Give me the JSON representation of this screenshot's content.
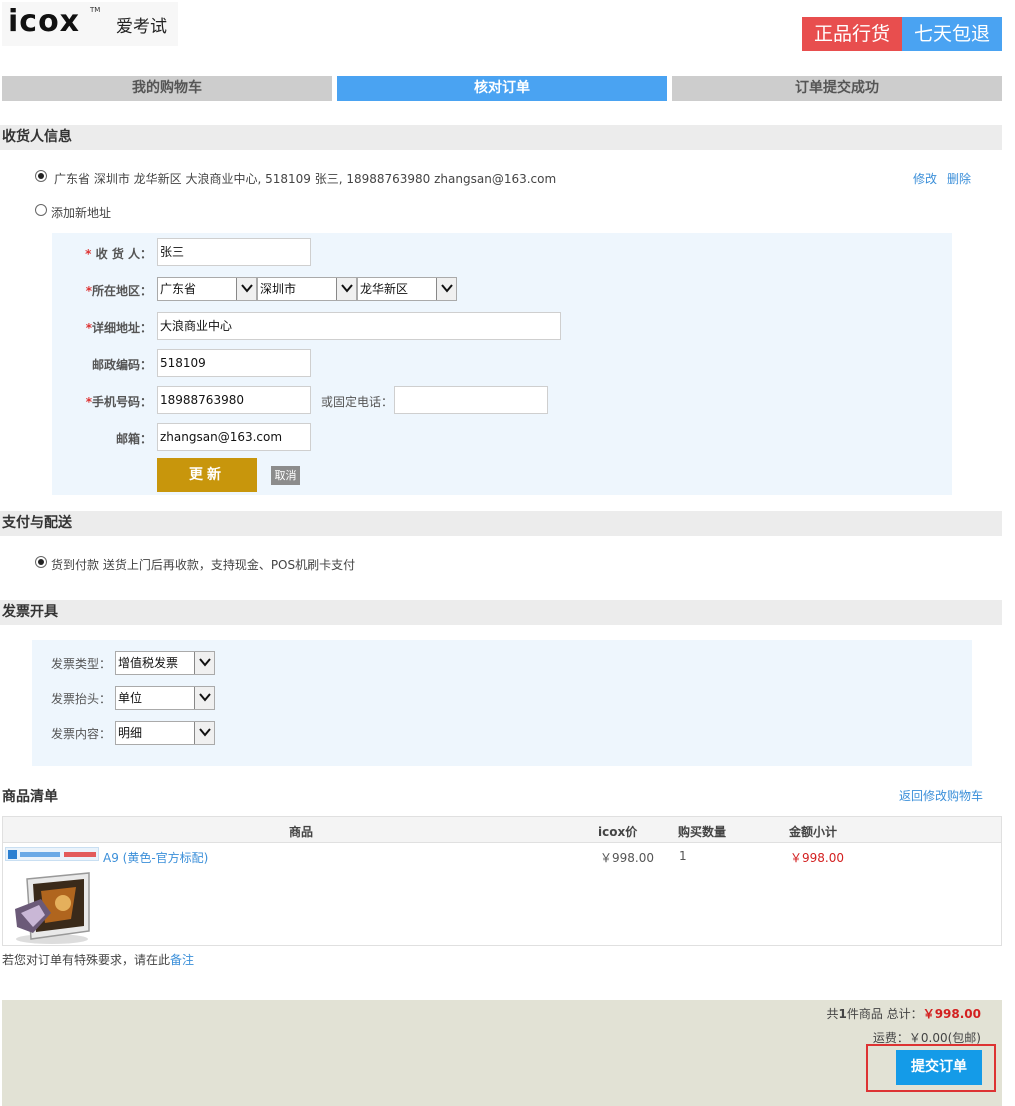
{
  "header": {
    "logo_mark": "icox",
    "logo_tm": "TM",
    "logo_cn": "爱考试",
    "badge_genuine": "正品行货",
    "badge_return": "七天包退"
  },
  "steps": [
    {
      "label": "我的购物车",
      "active": false
    },
    {
      "label": "核对订单",
      "active": true
    },
    {
      "label": "订单提交成功",
      "active": false
    }
  ],
  "receiver": {
    "section_title": "收货人信息",
    "saved_address": "广东省 深圳市 龙华新区 大浪商业中心, 518109 张三, 18988763980 zhangsan@163.com",
    "edit_label": "修改",
    "delete_label": "删除",
    "add_new_label": "添加新地址",
    "form": {
      "name_label": "收 货 人：",
      "name_value": "张三",
      "region_label": "所在地区：",
      "province": "广东省",
      "city": "深圳市",
      "district": "龙华新区",
      "address_label": "详细地址：",
      "address_value": "大浪商业中心",
      "postcode_label": "邮政编码：",
      "postcode_value": "518109",
      "mobile_label": "手机号码：",
      "mobile_value": "18988763980",
      "phone_label": "或固定电话：",
      "phone_value": "",
      "email_label": "邮箱：",
      "email_value": "zhangsan@163.com",
      "required_mark": "*",
      "update_label": "更新",
      "cancel_label": "取消"
    }
  },
  "payment": {
    "section_title": "支付与配送",
    "option": "货到付款 送货上门后再收款，支持现金、POS机刷卡支付"
  },
  "invoice": {
    "section_title": "发票开具",
    "type_label": "发票类型：",
    "type_value": "增值税发票",
    "title_label": "发票抬头：",
    "title_value": "单位",
    "content_label": "发票内容：",
    "content_value": "明细"
  },
  "goods": {
    "section_title": "商品清单",
    "back_link": "返回修改购物车",
    "columns": [
      "商品",
      "icox价",
      "购买数量",
      "金额小计"
    ],
    "rows": [
      {
        "name": "A9 (黄色-官方标配)",
        "price": "￥998.00",
        "qty": "1",
        "subtotal": "￥998.00"
      }
    ],
    "remark_prefix": "若您对订单有特殊要求，请在此",
    "remark_link": "备注"
  },
  "summary": {
    "count_prefix": "共",
    "count": "1",
    "count_suffix": "件商品 总计：",
    "total": "￥998.00",
    "shipping": "运费：￥0.00(包邮)",
    "submit_label": "提交订单"
  },
  "colors": {
    "accent_blue": "#4aa3f2",
    "badge_red": "#e84e4e",
    "update_gold": "#c8960c",
    "price_red": "#d32020"
  }
}
